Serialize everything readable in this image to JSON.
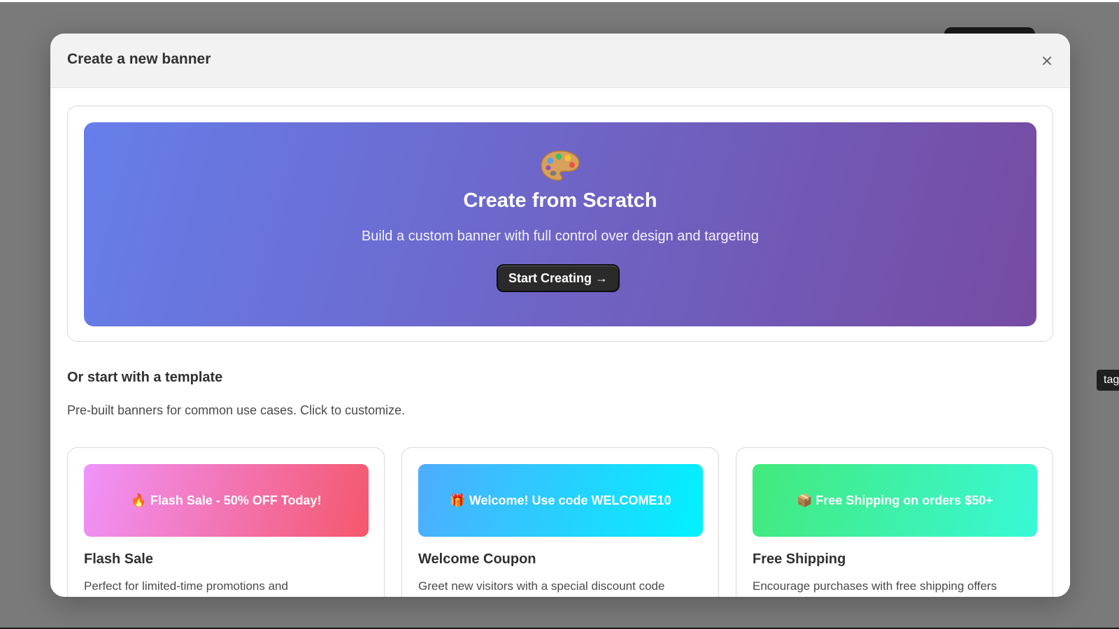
{
  "background": {
    "side_tag_label": "tag"
  },
  "modal": {
    "title": "Create a new banner",
    "close_icon": "close-icon"
  },
  "scratch": {
    "icon": "palette-icon",
    "title": "Create from Scratch",
    "description": "Build a custom banner with full control over design and targeting",
    "button_label": "Start Creating →",
    "gradient": [
      "#667eea",
      "#764ba2"
    ]
  },
  "templates": {
    "heading": "Or start with a template",
    "subheading": "Pre-built banners for common use cases. Click to customize.",
    "items": [
      {
        "preview_text": "🔥 Flash Sale - 50% OFF Today!",
        "preview_icon": "fire-icon",
        "name": "Flash Sale",
        "description": "Perfect for limited-time promotions and",
        "gradient": [
          "#f093fb",
          "#f5576c"
        ]
      },
      {
        "preview_text": "🎁 Welcome! Use code WELCOME10",
        "preview_icon": "gift-icon",
        "name": "Welcome Coupon",
        "description": "Greet new visitors with a special discount code",
        "gradient": [
          "#4facfe",
          "#00f2fe"
        ]
      },
      {
        "preview_text": "📦 Free Shipping on orders $50+",
        "preview_icon": "package-icon",
        "name": "Free Shipping",
        "description": "Encourage purchases with free shipping offers",
        "gradient": [
          "#43e97b",
          "#38f9d7"
        ]
      }
    ]
  }
}
